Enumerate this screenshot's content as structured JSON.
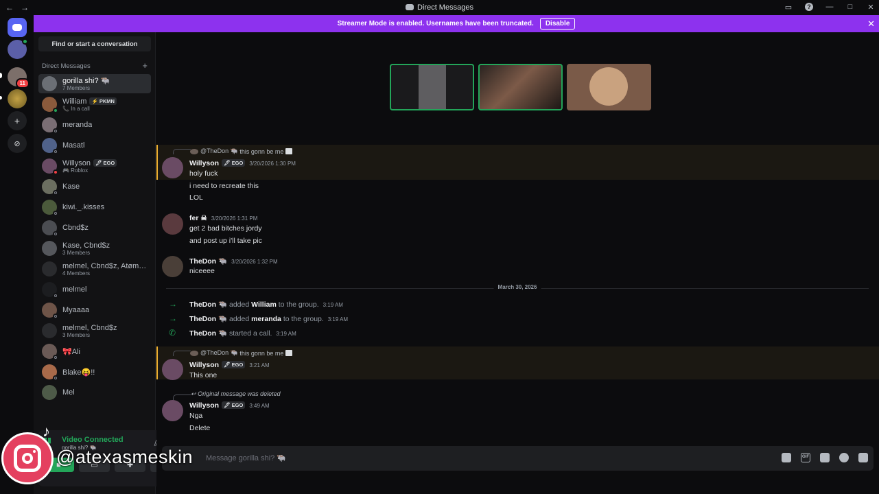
{
  "titlebar": {
    "title": "Direct Messages",
    "back_label": "←",
    "forward_label": "→",
    "help_label": "?",
    "minimize_label": "—",
    "maximize_label": "□",
    "close_label": "✕"
  },
  "banner": {
    "text": "Streamer Mode is enabled. Usernames have been truncated.",
    "button_label": "Disable",
    "close_label": "✕",
    "color": "#8d32ee"
  },
  "rail": {
    "unread_badge": "11",
    "add_label": "+",
    "discover_label": "⊘"
  },
  "sidebar": {
    "find_label": "Find or start a conversation",
    "section_label": "Direct Messages",
    "section_add": "+",
    "items": [
      {
        "name": "gorilla shi? 🐃",
        "sub": "7 Members",
        "status": "",
        "avatar": "#6b6f75"
      },
      {
        "name": "William",
        "tag": "⚡ PKMN",
        "sub": "📞 In a call",
        "status": "on",
        "avatar": "#8a5a3c"
      },
      {
        "name": "meranda",
        "sub": "",
        "status": "off",
        "avatar": "#7a6e74"
      },
      {
        "name": "Masatl",
        "sub": "",
        "status": "off",
        "avatar": "#50628a"
      },
      {
        "name": "Willyson",
        "tag": "🖋 EGO",
        "sub": "🎮 Roblox",
        "status": "dnd",
        "avatar": "#6a4b64"
      },
      {
        "name": "Kase",
        "sub": "",
        "status": "off",
        "avatar": "#6b6e60"
      },
      {
        "name": "kiwi._.kisses",
        "sub": "",
        "status": "off",
        "avatar": "#4b5a3b"
      },
      {
        "name": "Cbnd$z",
        "sub": "",
        "status": "off",
        "avatar": "#4b4d52"
      },
      {
        "name": "Kase, Cbnd$z",
        "sub": "3 Members",
        "status": "",
        "avatar": "#55575c"
      },
      {
        "name": "melmel, Cbnd$z, Atømicl...",
        "sub": "4 Members",
        "status": "",
        "avatar": "#2a2b2e"
      },
      {
        "name": "melmel",
        "sub": "",
        "status": "off",
        "avatar": "#1c1d20"
      },
      {
        "name": "Myaaaa",
        "sub": "",
        "status": "off",
        "avatar": "#6e5448"
      },
      {
        "name": "melmel, Cbnd$z",
        "sub": "3 Members",
        "status": "",
        "avatar": "#2a2b2e"
      },
      {
        "name": "🎀Ali",
        "sub": "",
        "status": "off",
        "avatar": "#6a5a56"
      },
      {
        "name": "Blake😝!!",
        "sub": "",
        "status": "off",
        "avatar": "#a86a4a"
      },
      {
        "name": "Mel",
        "sub": "",
        "status": "",
        "avatar": "#4d5a48"
      }
    ]
  },
  "voice": {
    "title": "Video Connected",
    "channel": "gorilla shi? 🐃"
  },
  "watermark": {
    "tiktok_icon": "♪",
    "handle": "@atexasmeskin"
  },
  "messages": {
    "reply1": {
      "author": "@TheDon 🐃",
      "text": "this gonn be me"
    },
    "m1": {
      "author": "Willyson",
      "tag": "🖋 EGO",
      "time": "3/20/2026 1:30 PM",
      "lines": [
        "holy fuck",
        "i need to recreate this",
        "LOL"
      ]
    },
    "m2": {
      "author": "fer ☠",
      "time": "3/20/2026 1:31 PM",
      "lines": [
        "get 2 bad bitches jordy",
        "and post up i'll take pic"
      ]
    },
    "m3": {
      "author": "TheDon 🐃",
      "time": "3/20/2026 1:32 PM",
      "lines": [
        "niceeee"
      ]
    },
    "divider": "March 30, 2026",
    "sys1": {
      "actor": "TheDon 🐃",
      "action": "added",
      "target": "William",
      "rest": "to the group.",
      "time": "3:19 AM"
    },
    "sys2": {
      "actor": "TheDon 🐃",
      "action": "added",
      "target": "meranda",
      "rest": "to the group.",
      "time": "3:19 AM"
    },
    "sys3": {
      "actor": "TheDon 🐃",
      "action": "started a call.",
      "time": "3:19 AM"
    },
    "reply2": {
      "author": "@TheDon 🐃",
      "text": "this gonn be me"
    },
    "m4": {
      "author": "Willyson",
      "tag": "🖋 EGO",
      "time": "3:21 AM",
      "lines": [
        "This one"
      ]
    },
    "deleted": "Original message was deleted",
    "m5": {
      "author": "Willyson",
      "tag": "🖋 EGO",
      "time": "3:49 AM",
      "lines": [
        "Nga",
        "Delete"
      ]
    }
  },
  "composer": {
    "placeholder": "Message gorilla shi? 🐃"
  },
  "colors": {
    "accent": "#5865f2",
    "online": "#23a559",
    "dnd": "#f23f43",
    "highlight_border": "#f0b232"
  }
}
